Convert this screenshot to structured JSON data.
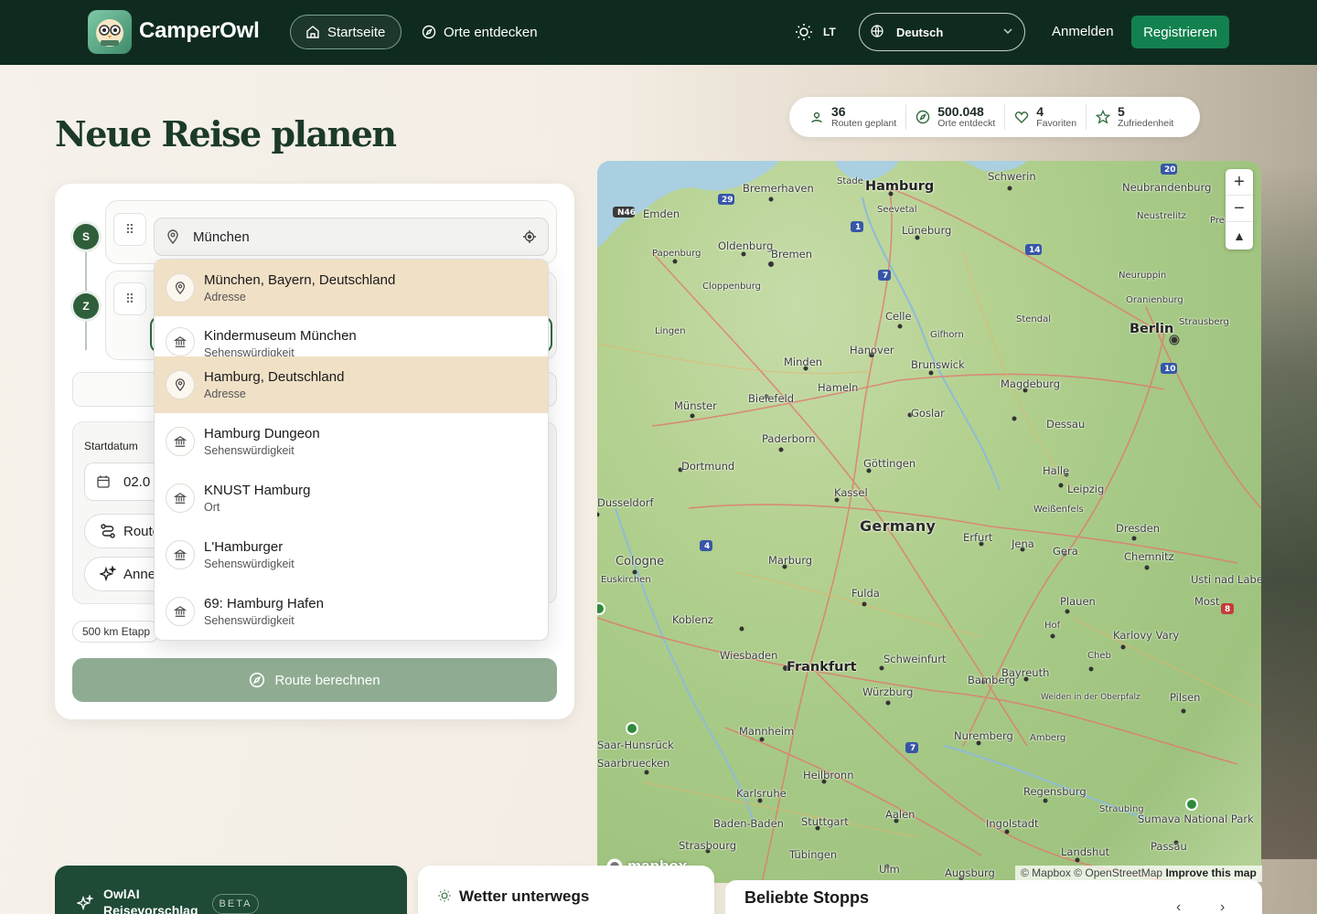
{
  "nav": {
    "brand": "CamperOwl",
    "home_label": "Startseite",
    "discover_label": "Orte entdecken",
    "theme_label": "LT",
    "language": "Deutsch",
    "login_label": "Anmelden",
    "register_label": "Registrieren"
  },
  "page": {
    "title": "Neue Reise planen"
  },
  "stats": [
    {
      "value": "36",
      "label": "Routen geplant",
      "icon": "route-icon"
    },
    {
      "value": "500.048",
      "label": "Orte entdeckt",
      "icon": "compass-icon"
    },
    {
      "value": "4",
      "label": "Favoriten",
      "icon": "heart-icon"
    },
    {
      "value": "5",
      "label": "Zufriedenheit",
      "icon": "star-icon"
    }
  ],
  "planner": {
    "start_marker": "S",
    "end_marker": "Z",
    "start_value": "München",
    "startdatum_label": "Startdatum",
    "date_value": "02.0",
    "route_btn": "Route",
    "anne_btn": "Anne",
    "stage_tag": "500 km Etapp",
    "calc_label": "Route berechnen"
  },
  "suggestions": [
    {
      "name": "München, Bayern, Deutschland",
      "type": "Adresse",
      "icon": "pin-icon",
      "highlighted": true
    },
    {
      "name": "Kindermuseum München",
      "type": "Sehenswürdigkeit",
      "icon": "museum-icon",
      "highlighted": false
    },
    {
      "name": "Hamburg, Deutschland",
      "type": "Adresse",
      "icon": "pin-icon",
      "highlighted": true
    },
    {
      "name": "Hamburg Dungeon",
      "type": "Sehenswürdigkeit",
      "icon": "museum-icon",
      "highlighted": false
    },
    {
      "name": "KNUST Hamburg",
      "type": "Ort",
      "icon": "museum-icon",
      "highlighted": false
    },
    {
      "name": "L'Hamburger",
      "type": "Sehenswürdigkeit",
      "icon": "museum-icon",
      "highlighted": false
    },
    {
      "name": "69: Hamburg Hafen",
      "type": "Sehenswürdigkeit",
      "icon": "museum-icon",
      "highlighted": false
    }
  ],
  "map": {
    "cities": [
      "Hamburg",
      "Schwerin",
      "Bremerhaven",
      "Neubrandenburg",
      "Emden",
      "Oldenburg",
      "Bremen",
      "Lüneburg",
      "Papenburg",
      "Cloppenburg",
      "Celle",
      "Berlin",
      "Lingen",
      "Hanover",
      "Stendal",
      "Magdeburg",
      "Minden",
      "Brunswick",
      "Bielefeld",
      "Hameln",
      "Münster",
      "Dessau",
      "Goslar",
      "Paderborn",
      "Halle",
      "Göttingen",
      "Dortmund",
      "Leipzig",
      "Kassel",
      "Dusseldorf",
      "Germany",
      "Erfurt",
      "Jena",
      "Gera",
      "Dresden",
      "Chemnitz",
      "Cologne",
      "Marburg",
      "Fulda",
      "Koblenz",
      "Plauen",
      "Wiesbaden",
      "Frankfurt",
      "Schweinfurt",
      "Bamberg",
      "Bayreuth",
      "Würzburg",
      "Mannheim",
      "Nuremberg",
      "Heilbronn",
      "Karlsruhe",
      "Regensburg",
      "Stuttgart",
      "Aalen",
      "Ingolstadt",
      "Strasbourg",
      "Tübingen",
      "Ulm",
      "Augsburg",
      "Landshut",
      "Passau",
      "Pilsen",
      "Karlovy Vary",
      "Saarbruecken",
      "Baden-Baden",
      "Gifhorn",
      "Wolfsburg",
      "Celle",
      "Neuruppin",
      "Oranienburg",
      "Strausberg",
      "Neustrelitz",
      "Prenzlau",
      "Seevetal",
      "Stade",
      "Weißenfels",
      "Euskirchen",
      "Most",
      "Usti nad Labem",
      "Šumava National Park",
      "Straubing",
      "Amberg",
      "Hof",
      "Cheb",
      "Weiden in der Oberpfalz",
      "Saar-Hunsrück"
    ],
    "logo": "mapbox",
    "attribution": "© Mapbox © OpenStreetMap",
    "improve": "Improve this map"
  },
  "bottom": {
    "owl_title": "OwlAI Reisevorschlag",
    "beta": "BETA",
    "weather_title": "Wetter unterwegs",
    "stops_title": "Beliebte Stopps"
  },
  "colors": {
    "nav_bg": "#0f2b1f",
    "accent": "#13814f",
    "highlight": "#f0e0c6",
    "calc_btn": "#8fac92"
  }
}
